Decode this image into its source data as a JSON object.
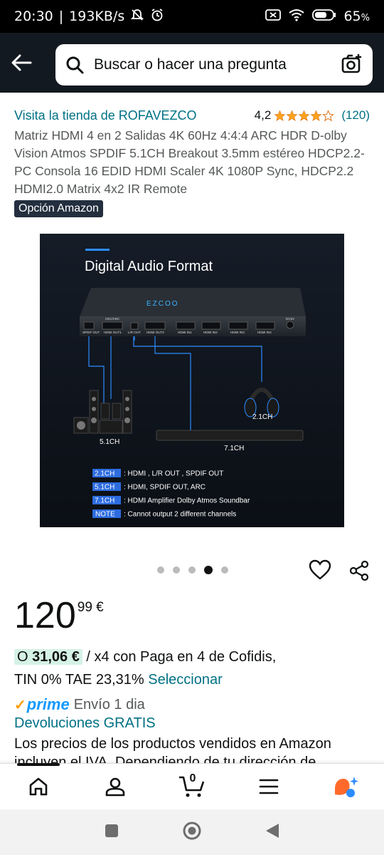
{
  "status_bar": {
    "time": "20:30",
    "speed": "193KB/s",
    "battery": "65"
  },
  "search": {
    "placeholder": "Buscar o hacer una pregunta"
  },
  "product": {
    "store_link": "Visita la tienda de ROFAVEZCO",
    "rating_value": "4,2",
    "rating_stars": 4.2,
    "review_count": "(120)",
    "title": "Matriz HDMI 4 en 2 Salidas 4K 60Hz 4:4:4 ARC HDR D-olby Vision Atmos SPDIF 5.1CH Breakout 3.5mm estéreo HDCP2.2- PC Consola 16 EDID HDMI Scaler 4K 1080P Sync, HDCP2.2 HDMI2.0 Matrix 4x2 IR Remote",
    "badge": "Opción Amazon"
  },
  "image": {
    "heading": "Digital Audio Format",
    "brand": "EZCOO",
    "ports": [
      "SPDIF OUT",
      "HDMI OUT1",
      "L/R OUT",
      "HDMI OUT2",
      "HDMI IN1",
      "HDMI IN2",
      "HDMI IN3",
      "HDMI IN4",
      "DC5V"
    ],
    "port_top_label": "CEC/ARC",
    "label_51": "5.1CH",
    "label_21": "2.1CH",
    "label_71": "7.1CH",
    "legend": [
      {
        "tag": "2.1CH",
        "text": ": HDMI , L/R OUT , SPDIF OUT"
      },
      {
        "tag": "5.1CH",
        "text": ": HDMI, SPDIF OUT, ARC"
      },
      {
        "tag": "7.1CH",
        "text": ": HDMI Amplifier Dolby Atmos Soundbar"
      },
      {
        "tag": "NOTE",
        "text": ": Cannot output 2 different channels"
      }
    ],
    "carousel_total": 5,
    "carousel_active": 4
  },
  "price": {
    "whole": "120",
    "fraction": "99 €"
  },
  "installments": {
    "prefix": "O ",
    "amount": "31,06 €",
    "text": " / x4 con Paga en 4 de Cofidis,",
    "text2": "TIN 0% TAE 23,31% ",
    "link": "Seleccionar"
  },
  "delivery": {
    "prime_label": "prime",
    "shipping": "Envío 1 dia",
    "returns": "Devoluciones GRATIS",
    "taxes_line1": "Los precios de los productos vendidos en Amazon",
    "taxes_line2": "incluyen el IVA. Dependiendo de tu dirección de"
  },
  "bottom_nav": {
    "cart_count": "0"
  },
  "colors": {
    "header_bg": "#131921",
    "link": "#007185",
    "star": "#ffa41c",
    "prime_blue": "#1399ff",
    "installment_bg": "#d5f2e6"
  }
}
